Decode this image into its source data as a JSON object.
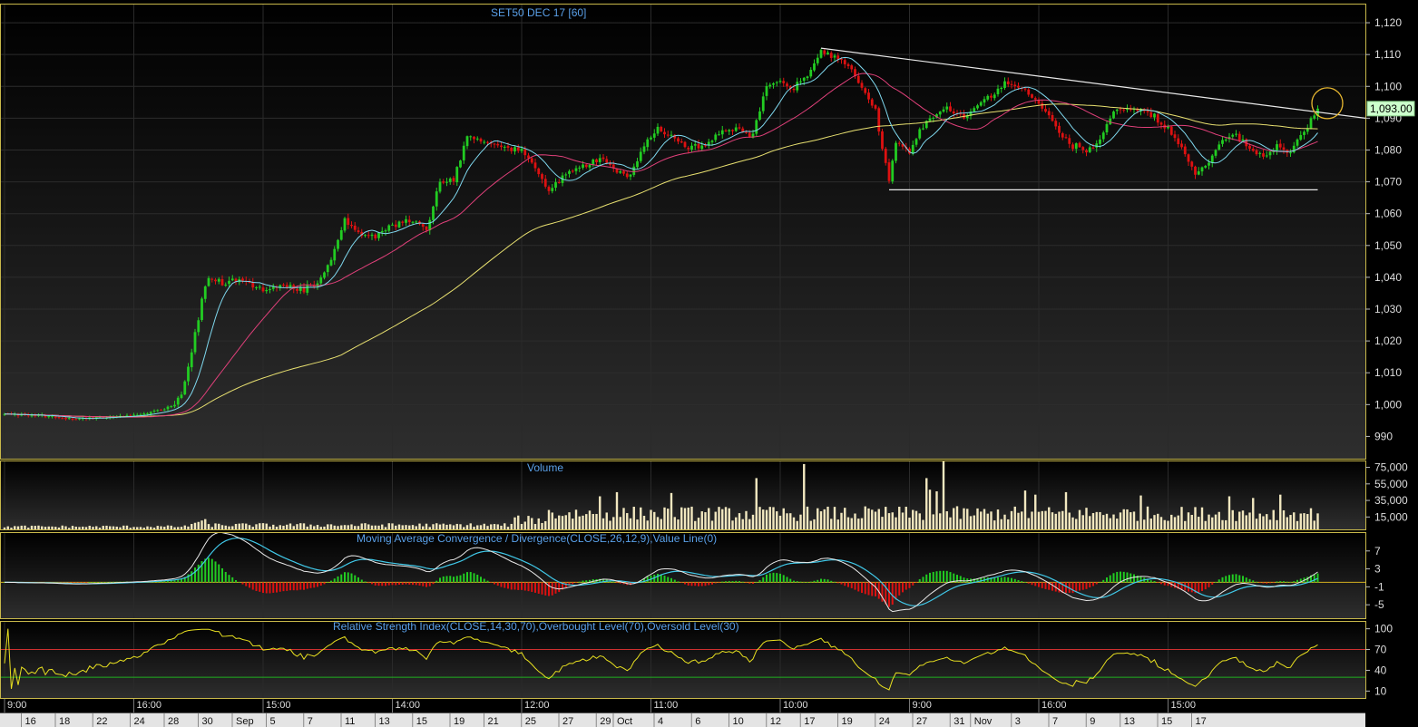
{
  "chart_data": [
    {
      "type": "candlestick",
      "title": "SET50 DEC 17   [60]",
      "ylim": [
        983,
        1126
      ],
      "yticks": [
        990,
        1000,
        1010,
        1020,
        1030,
        1040,
        1050,
        1060,
        1070,
        1080,
        1090,
        1100,
        1110,
        1120
      ],
      "ytick_labels": [
        "990",
        "1,000",
        "1,010",
        "1,020",
        "1,030",
        "1,040",
        "1,050",
        "1,060",
        "1,070",
        "1,080",
        "1,090",
        "1,100",
        "1,110",
        "1,120"
      ],
      "last_price": 1093.0,
      "last_price_label": "1,093.00",
      "up_color": "#22cc22",
      "down_color": "#dd1111",
      "anchors": [
        [
          0,
          997
        ],
        [
          10,
          996.5
        ],
        [
          20,
          995.5
        ],
        [
          30,
          996
        ],
        [
          40,
          997
        ],
        [
          45,
          998
        ],
        [
          50,
          1000
        ],
        [
          52,
          1004
        ],
        [
          54,
          1012
        ],
        [
          56,
          1022
        ],
        [
          58,
          1035
        ],
        [
          60,
          1040
        ],
        [
          64,
          1038
        ],
        [
          70,
          1039
        ],
        [
          76,
          1036
        ],
        [
          82,
          1037
        ],
        [
          88,
          1036
        ],
        [
          92,
          1038
        ],
        [
          96,
          1046
        ],
        [
          100,
          1058
        ],
        [
          104,
          1054
        ],
        [
          108,
          1053
        ],
        [
          114,
          1056
        ],
        [
          120,
          1058
        ],
        [
          124,
          1055
        ],
        [
          128,
          1070
        ],
        [
          132,
          1070
        ],
        [
          136,
          1085
        ],
        [
          140,
          1083
        ],
        [
          146,
          1081
        ],
        [
          152,
          1080
        ],
        [
          156,
          1074
        ],
        [
          160,
          1067
        ],
        [
          164,
          1071
        ],
        [
          168,
          1074
        ],
        [
          172,
          1076
        ],
        [
          176,
          1077
        ],
        [
          180,
          1073
        ],
        [
          184,
          1072
        ],
        [
          188,
          1082
        ],
        [
          192,
          1087
        ],
        [
          196,
          1084
        ],
        [
          200,
          1081
        ],
        [
          204,
          1081
        ],
        [
          208,
          1083
        ],
        [
          212,
          1087
        ],
        [
          216,
          1086
        ],
        [
          220,
          1085
        ],
        [
          224,
          1100
        ],
        [
          228,
          1102
        ],
        [
          232,
          1099
        ],
        [
          236,
          1104
        ],
        [
          240,
          1111
        ],
        [
          244,
          1109
        ],
        [
          248,
          1107
        ],
        [
          252,
          1100
        ],
        [
          256,
          1092
        ],
        [
          258,
          1080
        ],
        [
          260,
          1070
        ],
        [
          262,
          1082
        ],
        [
          266,
          1080
        ],
        [
          270,
          1088
        ],
        [
          276,
          1093
        ],
        [
          282,
          1090
        ],
        [
          288,
          1096
        ],
        [
          294,
          1101
        ],
        [
          300,
          1099
        ],
        [
          304,
          1095
        ],
        [
          308,
          1089
        ],
        [
          314,
          1081
        ],
        [
          318,
          1080
        ],
        [
          322,
          1083
        ],
        [
          326,
          1092
        ],
        [
          332,
          1093
        ],
        [
          336,
          1092
        ],
        [
          340,
          1088
        ],
        [
          344,
          1084
        ],
        [
          348,
          1077
        ],
        [
          350,
          1072
        ],
        [
          354,
          1077
        ],
        [
          358,
          1083
        ],
        [
          362,
          1085
        ],
        [
          366,
          1080
        ],
        [
          370,
          1078
        ],
        [
          374,
          1081
        ],
        [
          378,
          1079
        ],
        [
          382,
          1086
        ],
        [
          386,
          1093
        ]
      ],
      "ma_fast": {
        "color": "#7fd8ee",
        "period": 10
      },
      "ma_mid": {
        "color": "#e0407a",
        "period": 30
      },
      "ma_slow": {
        "color": "#e8e070",
        "period": 100
      },
      "trendline": {
        "from": [
          240,
          1112
        ],
        "to": [
          410,
          1090
        ],
        "color": "#e8e8e8"
      },
      "support": {
        "from": [
          260,
          1067.5
        ],
        "to": [
          386,
          1067.5
        ],
        "color": "#e8e8e8"
      },
      "highlight_circle": {
        "at": [
          388,
          1093
        ],
        "color": "#e8b830"
      }
    },
    {
      "type": "bar",
      "title": "Volume",
      "yticks": [
        15000,
        35000,
        55000,
        75000
      ],
      "ytick_labels": [
        "15,000",
        "35,000",
        "55,000",
        "75,000"
      ],
      "ylim": [
        0,
        80000
      ],
      "bar_color": "#f2e8c0",
      "spikes": [
        [
          235,
          79000
        ],
        [
          276,
          87000
        ],
        [
          271,
          62000
        ],
        [
          272,
          48000
        ],
        [
          274,
          46000
        ],
        [
          221,
          62000
        ],
        [
          175,
          40000
        ],
        [
          180,
          45000
        ],
        [
          196,
          44000
        ],
        [
          303,
          42000
        ],
        [
          300,
          47000
        ],
        [
          312,
          45000
        ],
        [
          334,
          41000
        ],
        [
          360,
          40000
        ],
        [
          367,
          38000
        ],
        [
          375,
          42000
        ]
      ]
    },
    {
      "type": "line",
      "title": "Moving Average Convergence / Divergence(CLOSE,26,12,9),Value Line(0)",
      "yticks": [
        -5,
        -1,
        3,
        7
      ],
      "ytick_labels": [
        "-5",
        "-1",
        "3",
        "7"
      ],
      "ylim": [
        -8,
        11
      ],
      "macd_color": "#e8e8e8",
      "signal_color": "#40c8e8",
      "hist_up_color": "#22cc22",
      "hist_down_color": "#dd1111",
      "zero_color": "#d4b020"
    },
    {
      "type": "line",
      "title": "Relative Strength Index(CLOSE,14,30,70),Overbought Level(70),Oversold Level(30)",
      "yticks": [
        10,
        40,
        70,
        100
      ],
      "ytick_labels": [
        "10",
        "40",
        "70",
        "100"
      ],
      "ylim": [
        0,
        110
      ],
      "overbought": 70,
      "oversold": 30,
      "line_color": "#e8e020",
      "overbought_color": "#d03030",
      "oversold_color": "#20b020"
    }
  ],
  "xaxis": {
    "time_labels": [
      [
        "9:00",
        0
      ],
      [
        "16:00",
        38
      ],
      [
        "15:00",
        76
      ],
      [
        "14:00",
        114
      ],
      [
        "12:00",
        152
      ],
      [
        "11:00",
        190
      ],
      [
        "10:00",
        228
      ],
      [
        "9:00",
        266
      ],
      [
        "16:00",
        304
      ],
      [
        "15:00",
        342
      ]
    ],
    "date_labels": [
      [
        "16",
        6
      ],
      [
        "18",
        16
      ],
      [
        "22",
        27
      ],
      [
        "24",
        38
      ],
      [
        "28",
        48
      ],
      [
        "30",
        58
      ],
      [
        "Sep",
        68
      ],
      [
        "5",
        78
      ],
      [
        "7",
        89
      ],
      [
        "11",
        100
      ],
      [
        "13",
        110
      ],
      [
        "15",
        121
      ],
      [
        "19",
        132
      ],
      [
        "21",
        142
      ],
      [
        "25",
        153
      ],
      [
        "27",
        164
      ],
      [
        "29",
        175
      ],
      [
        "Oct",
        180
      ],
      [
        "4",
        192
      ],
      [
        "6",
        203
      ],
      [
        "10",
        214
      ],
      [
        "12",
        225
      ],
      [
        "17",
        235
      ],
      [
        "19",
        246
      ],
      [
        "24",
        257
      ],
      [
        "27",
        268
      ],
      [
        "31",
        279
      ],
      [
        "Nov",
        285
      ],
      [
        "3",
        297
      ],
      [
        "7",
        308
      ],
      [
        "9",
        319
      ],
      [
        "13",
        329
      ],
      [
        "15",
        340
      ],
      [
        "17",
        350
      ]
    ]
  }
}
